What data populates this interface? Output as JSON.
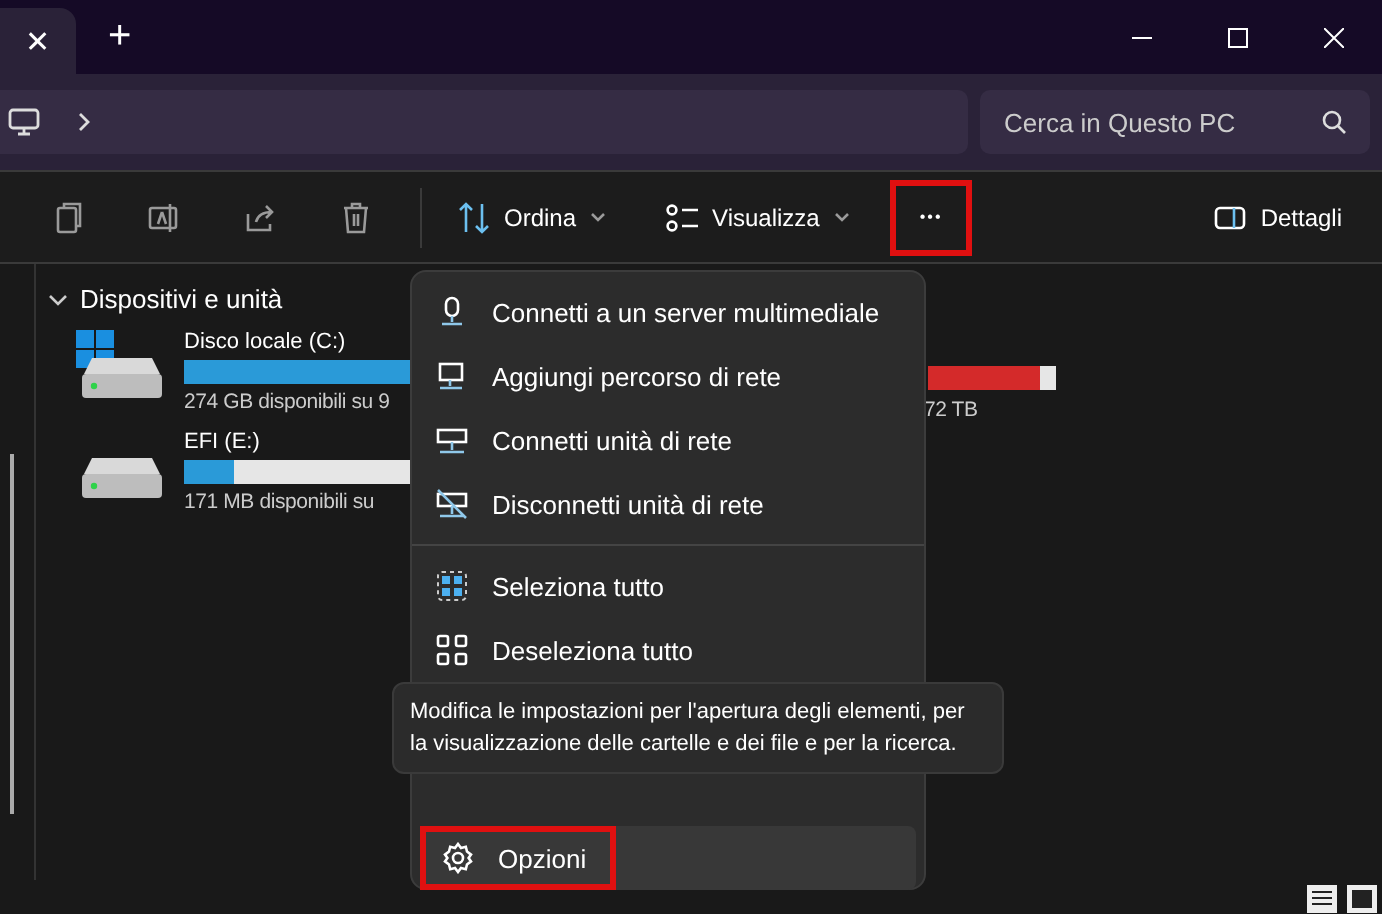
{
  "tab_strip": {
    "close_glyph": "✕",
    "new_tab_glyph": "+"
  },
  "search": {
    "placeholder": "Cerca in Questo PC"
  },
  "toolbar": {
    "sort": "Ordina",
    "view": "Visualizza",
    "more": "•••",
    "more_highlighted": true,
    "details": "Dettagli"
  },
  "section": {
    "title": "Dispositivi e unità",
    "expanded": true
  },
  "drives": [
    {
      "name": "Disco locale (C:)",
      "kind": "system",
      "usage": "274 GB disponibili su 9",
      "level": 0.72,
      "color": "#2a9ad8"
    },
    {
      "name": "EFI (E:)",
      "kind": "plain",
      "usage": "171 MB disponibili su",
      "level": 0.13,
      "color": "#2a9ad8"
    }
  ],
  "hidden_drive": {
    "usage": "72 TB",
    "color": "#d42a2a"
  },
  "menu": {
    "items": [
      {
        "label": "Connetti a un server multimediale",
        "separator_before": false
      },
      {
        "label": "Aggiungi percorso di rete",
        "separator_before": false
      },
      {
        "label": "Connetti unità di rete",
        "separator_before": false
      },
      {
        "label": "Disconnetti unità di rete",
        "separator_before": false
      },
      {
        "label": "Seleziona tutto",
        "separator_before": true
      },
      {
        "label": "Deseleziona tutto",
        "separator_before": false
      }
    ],
    "last": {
      "label": "Opzioni",
      "hovered": true,
      "highlighted": true
    }
  },
  "tooltip": "Modifica le impostazioni per l'apertura degli elementi, per la visualizzazione delle cartelle e dei file e per la ricerca."
}
